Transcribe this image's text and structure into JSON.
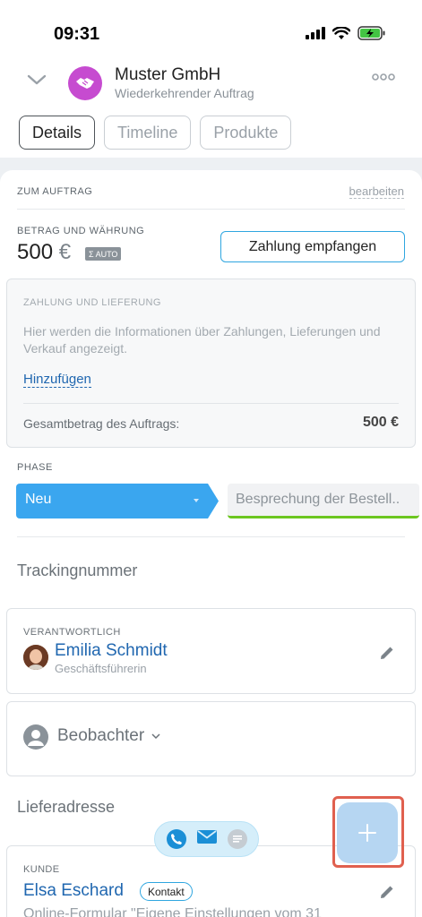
{
  "status_bar": {
    "time": "09:31"
  },
  "header": {
    "title": "Muster GmbH",
    "subtitle": "Wiederkehrender Auftrag",
    "tabs": [
      {
        "label": "Details",
        "active": true
      },
      {
        "label": "Timeline",
        "active": false
      },
      {
        "label": "Produkte",
        "active": false
      }
    ]
  },
  "order": {
    "section_title": "ZUM AUFTRAG",
    "edit_label": "bearbeiten",
    "amount_label": "BETRAG UND WÄHRUNG",
    "amount_value": "500",
    "currency": "€",
    "auto_badge": "AUTO",
    "receive_payment_button": "Zahlung empfangen"
  },
  "payment": {
    "label": "ZAHLUNG UND LIEFERUNG",
    "description": "Hier werden die Informationen über Zahlungen, Lieferungen und Verkauf angezeigt.",
    "add_link": "Hinzufügen",
    "total_label": "Gesamtbetrag des Auftrags:",
    "total_value": "500 €"
  },
  "phase": {
    "label": "PHASE",
    "current": "Neu",
    "next": "Besprechung der Bestell..",
    "current_color": "#3aa6ef",
    "next_color": "#6cc620"
  },
  "tracking": {
    "label": "Trackingnummer"
  },
  "responsible": {
    "label": "VERANTWORTLICH",
    "name": "Emilia Schmidt",
    "role": "Geschäftsführerin"
  },
  "observers": {
    "label": "Beobachter"
  },
  "delivery": {
    "label": "Lieferadresse"
  },
  "customer": {
    "label": "KUNDE",
    "name": "Elsa Eschard",
    "badge": "Kontakt",
    "description": "Online-Formular \"Eigene Einstellungen vom 31"
  },
  "colors": {
    "accent": "#2fa6e0",
    "link": "#2067b0",
    "avatar": "#c64bd0"
  }
}
